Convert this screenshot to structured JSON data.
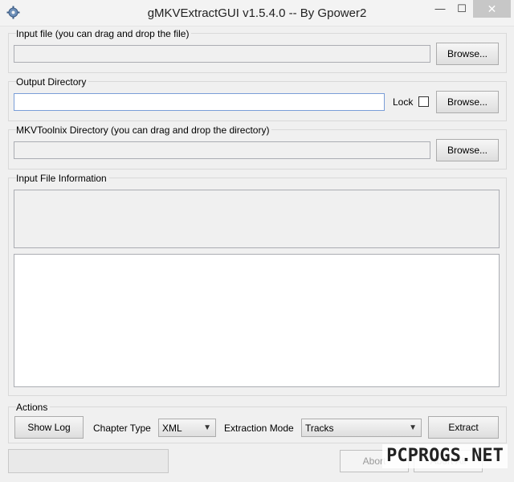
{
  "window": {
    "title": "gMKVExtractGUI v1.5.4.0 -- By Gpower2",
    "icon": "app-gear-icon",
    "controls": {
      "minimize": "—",
      "maximize": "☐",
      "close": "✕"
    }
  },
  "input_file": {
    "label": "Input file (you can drag and drop the file)",
    "value": "",
    "browse_label": "Browse..."
  },
  "output_directory": {
    "label": "Output Directory",
    "value": "",
    "lock_label": "Lock",
    "lock_checked": false,
    "browse_label": "Browse..."
  },
  "mkvtoolnix_directory": {
    "label": "MKVToolnix Directory (you can drag and drop the directory)",
    "value": "",
    "browse_label": "Browse..."
  },
  "input_file_information": {
    "label": "Input File Information",
    "content": ""
  },
  "log": {
    "content": ""
  },
  "actions": {
    "label": "Actions",
    "show_log_label": "Show Log",
    "chapter_type_label": "Chapter Type",
    "chapter_type_value": "XML",
    "extraction_mode_label": "Extraction Mode",
    "extraction_mode_value": "Tracks",
    "extract_label": "Extract"
  },
  "status": {
    "abort_label": "Abort",
    "abort_all_label": "Abort All"
  },
  "watermark": {
    "text": "PCPROGS.NET"
  },
  "colors": {
    "window_bg": "#f0f0f0",
    "border": "#d9d9d9",
    "close_button": "#c7c7c7"
  }
}
